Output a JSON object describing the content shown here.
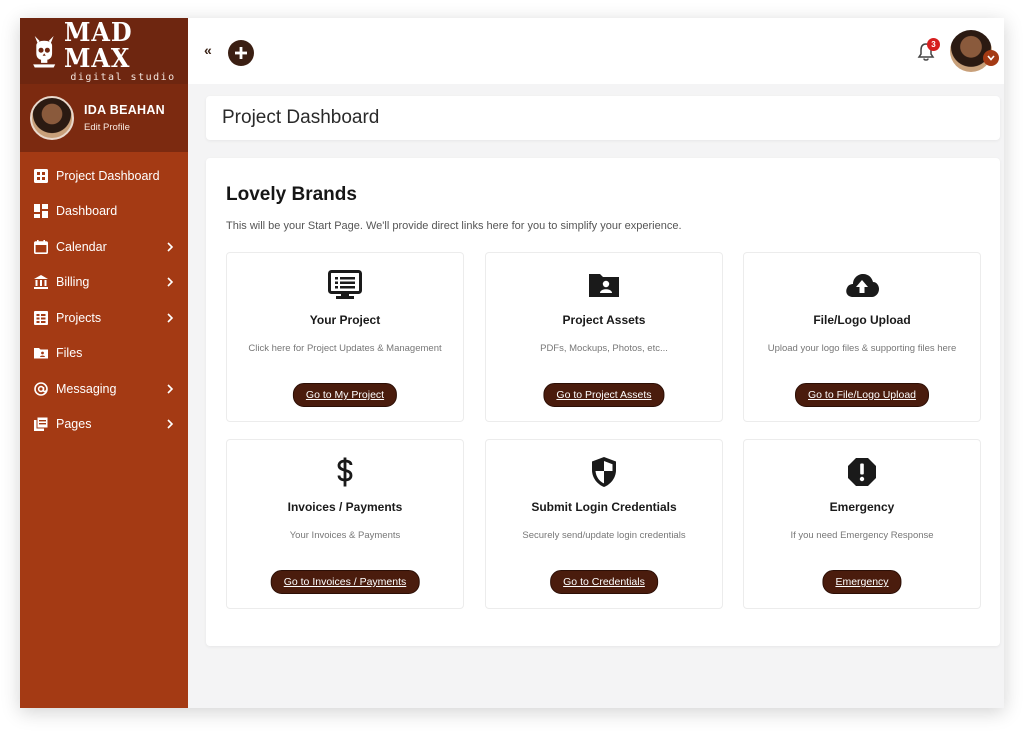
{
  "brand": {
    "name": "MAD MAX",
    "subtitle": "digital studio"
  },
  "user": {
    "name": "IDA BEAHAN",
    "edit_label": "Edit Profile"
  },
  "sidebar": {
    "items": [
      {
        "label": "Project Dashboard",
        "icon": "project-dashboard-icon",
        "has_children": false
      },
      {
        "label": "Dashboard",
        "icon": "dashboard-icon",
        "has_children": false
      },
      {
        "label": "Calendar",
        "icon": "calendar-icon",
        "has_children": true
      },
      {
        "label": "Billing",
        "icon": "bank-icon",
        "has_children": true
      },
      {
        "label": "Projects",
        "icon": "projects-icon",
        "has_children": true
      },
      {
        "label": "Files",
        "icon": "folder-icon",
        "has_children": false
      },
      {
        "label": "Messaging",
        "icon": "at-icon",
        "has_children": true
      },
      {
        "label": "Pages",
        "icon": "pages-icon",
        "has_children": true
      }
    ]
  },
  "topbar": {
    "collapse_label": "«",
    "notification_count": "3"
  },
  "page": {
    "title": "Project Dashboard"
  },
  "panel": {
    "title": "Lovely Brands",
    "subtitle": "This will be your Start Page. We'll provide direct links here for you to simplify your experience."
  },
  "cards": [
    {
      "title": "Your Project",
      "desc": "Click here for Project Updates & Management",
      "button": "Go to My Project",
      "icon": "monitor-list-icon"
    },
    {
      "title": "Project Assets",
      "desc": "PDFs, Mockups, Photos, etc...",
      "button": "Go to Project Assets",
      "icon": "folder-user-icon"
    },
    {
      "title": "File/Logo Upload",
      "desc": "Upload your logo files & supporting files here",
      "button": "Go to File/Logo Upload",
      "icon": "cloud-upload-icon"
    },
    {
      "title": "Invoices / Payments",
      "desc": "Your Invoices & Payments",
      "button": "Go to Invoices / Payments",
      "icon": "dollar-icon"
    },
    {
      "title": "Submit Login Credentials",
      "desc": "Securely send/update login credentials",
      "button": "Go to Credentials",
      "icon": "shield-icon"
    },
    {
      "title": "Emergency",
      "desc": "If you need Emergency Response",
      "button": "Emergency",
      "icon": "alert-octagon-icon"
    }
  ],
  "colors": {
    "sidebar": "#a43a14",
    "brand_bg": "#6e2610",
    "button": "#4a1c0d",
    "badge": "#d61f1f"
  }
}
